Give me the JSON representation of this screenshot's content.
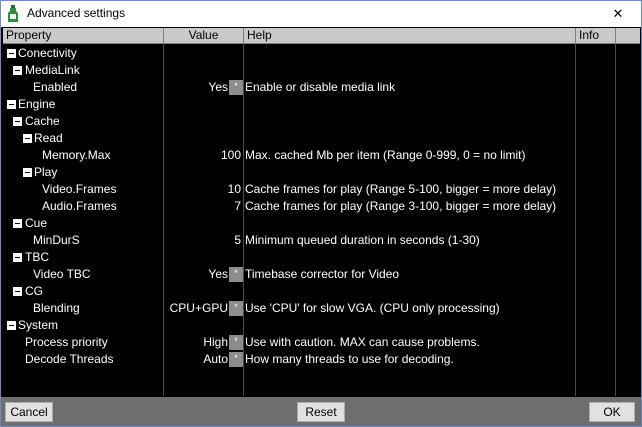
{
  "window": {
    "title": "Advanced settings",
    "close_glyph": "✕"
  },
  "columns": {
    "property": "Property",
    "value": "Value",
    "help": "Help",
    "info": "Info"
  },
  "rows": [
    {
      "label": "Conectivity",
      "toggle": true,
      "level": 0,
      "value": "",
      "button": false,
      "help": ""
    },
    {
      "label": "MediaLink",
      "toggle": true,
      "level": 1,
      "value": "",
      "button": false,
      "help": ""
    },
    {
      "label": "Enabled",
      "toggle": false,
      "level": 2,
      "value": "Yes",
      "button": true,
      "help": "Enable or disable media link"
    },
    {
      "label": "Engine",
      "toggle": true,
      "level": 0,
      "value": "",
      "button": false,
      "help": ""
    },
    {
      "label": "Cache",
      "toggle": true,
      "level": 1,
      "value": "",
      "button": false,
      "help": ""
    },
    {
      "label": "Read",
      "toggle": true,
      "level": 2,
      "value": "",
      "button": false,
      "help": ""
    },
    {
      "label": "Memory.Max",
      "toggle": false,
      "level": 3,
      "value": "100",
      "button": false,
      "help": "Max. cached Mb per item (Range 0-999, 0 = no limit)"
    },
    {
      "label": "Play",
      "toggle": true,
      "level": 2,
      "value": "",
      "button": false,
      "help": ""
    },
    {
      "label": "Video.Frames",
      "toggle": false,
      "level": 3,
      "value": "10",
      "button": false,
      "help": "Cache frames for play (Range 5-100, bigger = more delay)"
    },
    {
      "label": "Audio.Frames",
      "toggle": false,
      "level": 3,
      "value": "7",
      "button": false,
      "help": "Cache frames for play (Range 3-100, bigger = more delay)"
    },
    {
      "label": "Cue",
      "toggle": true,
      "level": 1,
      "value": "",
      "button": false,
      "help": ""
    },
    {
      "label": "MinDurS",
      "toggle": false,
      "level": 2,
      "value": "5",
      "button": false,
      "help": "Minimum queued duration in seconds (1-30)"
    },
    {
      "label": "TBC",
      "toggle": true,
      "level": 1,
      "value": "",
      "button": false,
      "help": ""
    },
    {
      "label": "Video TBC",
      "toggle": false,
      "level": 2,
      "value": "Yes",
      "button": true,
      "help": "Timebase corrector for Video"
    },
    {
      "label": "CG",
      "toggle": true,
      "level": 1,
      "value": "",
      "button": false,
      "help": ""
    },
    {
      "label": "Blending",
      "toggle": false,
      "level": 2,
      "value": "CPU+GPU",
      "button": true,
      "help": "Use 'CPU' for slow VGA. (CPU only processing)"
    },
    {
      "label": "System",
      "toggle": true,
      "level": 0,
      "value": "",
      "button": false,
      "help": ""
    },
    {
      "label": "Process priority",
      "toggle": false,
      "level": 1,
      "value": "High",
      "button": true,
      "help": "Use with caution. MAX can cause problems."
    },
    {
      "label": "Decode Threads",
      "toggle": false,
      "level": 1,
      "value": "Auto",
      "button": true,
      "help": "How many threads to use for decoding."
    }
  ],
  "edit_button_glyph": "*",
  "footer": {
    "cancel": "Cancel",
    "reset": "Reset",
    "ok": "OK"
  },
  "colors": {
    "background": "#000000",
    "header": "#c9c9c9",
    "footer": "#6e6e6e",
    "edit_button": "#8c8c8c"
  }
}
